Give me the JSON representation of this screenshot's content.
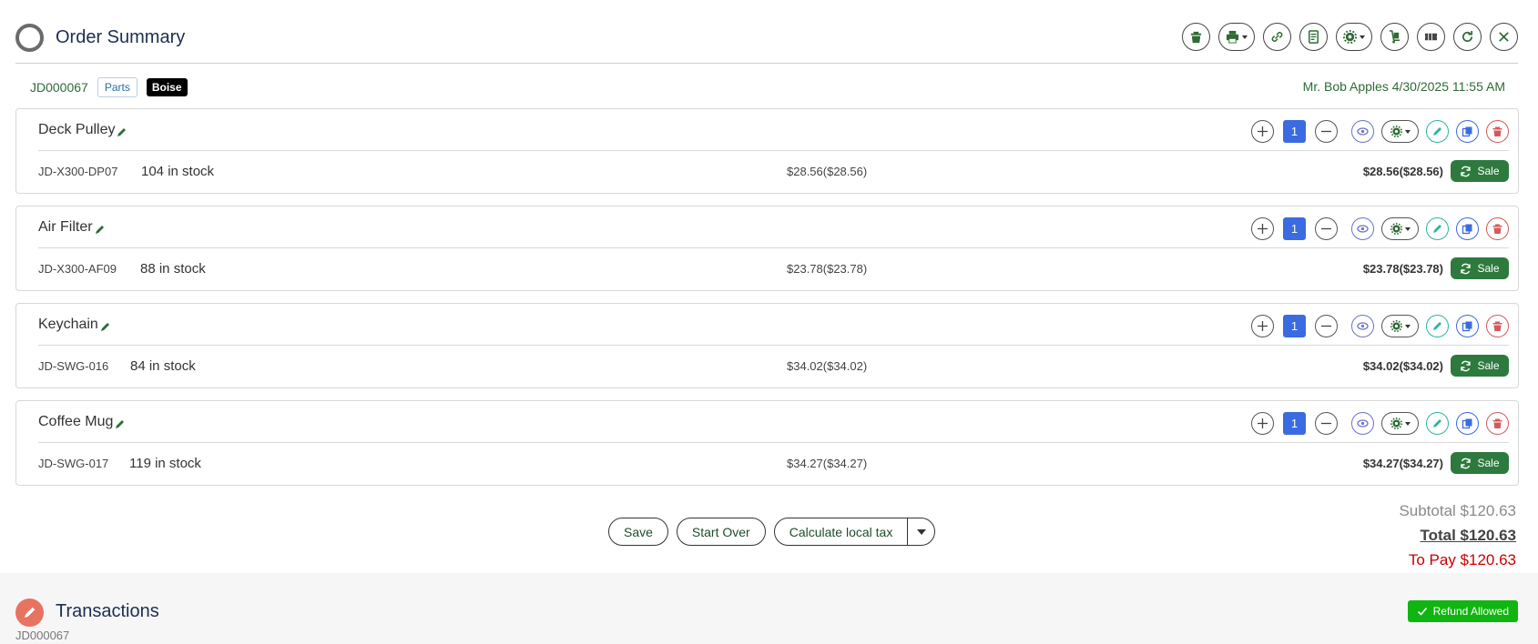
{
  "header": {
    "title": "Order Summary",
    "toolbar": [
      "trash-icon",
      "print-icon",
      "link-icon",
      "receipt-icon",
      "gear-icon",
      "hand-truck-icon",
      "ticket-icon",
      "refresh-icon",
      "close-icon"
    ]
  },
  "order": {
    "id": "JD000067",
    "type_tag": "Parts",
    "location_tag": "Boise",
    "customer": "Mr. Bob Apples 4/30/2025 11:55 AM"
  },
  "items": [
    {
      "name": "Deck Pulley",
      "sku": "JD-X300-DP07",
      "stock": "104 in stock",
      "qty": "1",
      "unit_price": "$28.56($28.56)",
      "line_total": "$28.56($28.56)",
      "badge": "Sale"
    },
    {
      "name": "Air Filter",
      "sku": "JD-X300-AF09",
      "stock": "88 in stock",
      "qty": "1",
      "unit_price": "$23.78($23.78)",
      "line_total": "$23.78($23.78)",
      "badge": "Sale"
    },
    {
      "name": "Keychain",
      "sku": "JD-SWG-016",
      "stock": "84 in stock",
      "qty": "1",
      "unit_price": "$34.02($34.02)",
      "line_total": "$34.02($34.02)",
      "badge": "Sale"
    },
    {
      "name": "Coffee Mug",
      "sku": "JD-SWG-017",
      "stock": "119 in stock",
      "qty": "1",
      "unit_price": "$34.27($34.27)",
      "line_total": "$34.27($34.27)",
      "badge": "Sale"
    }
  ],
  "actions": {
    "save": "Save",
    "start_over": "Start Over",
    "calc_tax": "Calculate local tax"
  },
  "totals": {
    "subtotal": "Subtotal $120.63",
    "total": "Total $120.63",
    "to_pay": "To Pay $120.63"
  },
  "transactions": {
    "title": "Transactions",
    "order_id": "JD000067",
    "refund": "Refund Allowed"
  },
  "colors": {
    "accent_green": "#2e7a3e",
    "qty_blue": "#3b6be0",
    "to_pay_red": "#cc0000",
    "refund_green": "#11b511"
  }
}
